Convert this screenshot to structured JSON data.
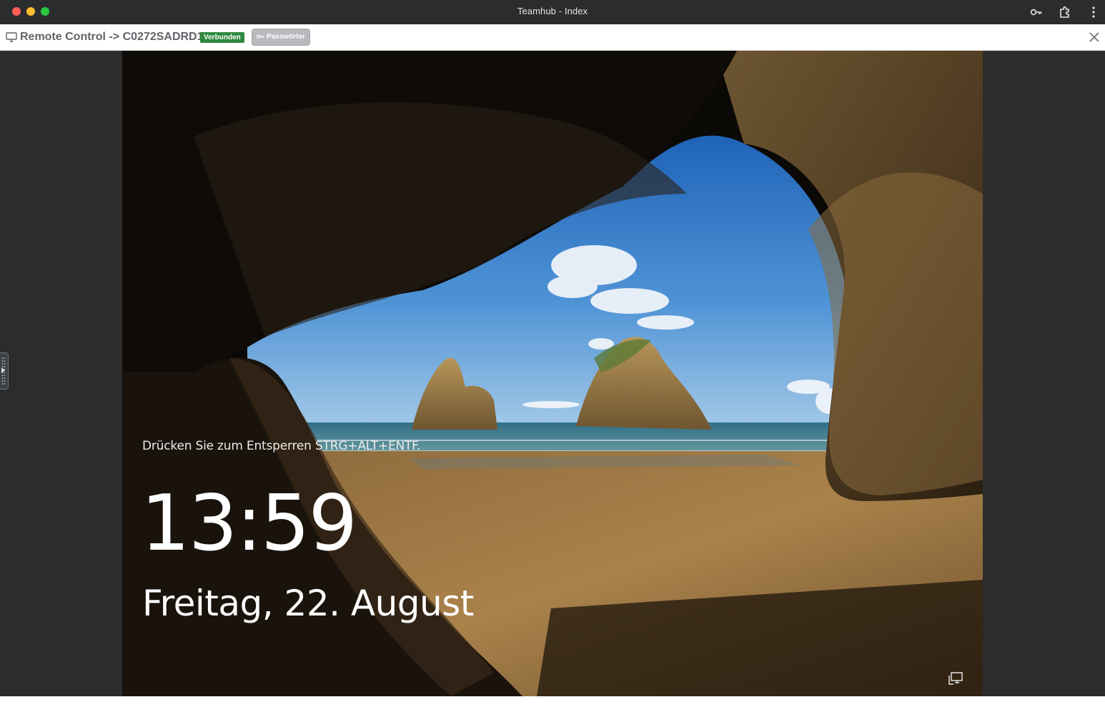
{
  "window": {
    "title": "Teamhub - Index",
    "toolbar_icons": [
      "key-icon",
      "extension-puzzle-icon",
      "more-vertical-icon"
    ]
  },
  "appbar": {
    "title": "Remote Control -> C0272SADRD1",
    "status_badge": "Verbunden",
    "passwords_button": "Passwörter",
    "colors": {
      "status": "#2f8a3f",
      "button": "#b7b9bc",
      "title": "#606468"
    }
  },
  "lockscreen": {
    "hint": "Drücken Sie zum Entsperren STRG+ALT+ENTF.",
    "time": "13:59",
    "date": "Freitag, 22. August",
    "network_icon": "network-monitor-icon"
  }
}
